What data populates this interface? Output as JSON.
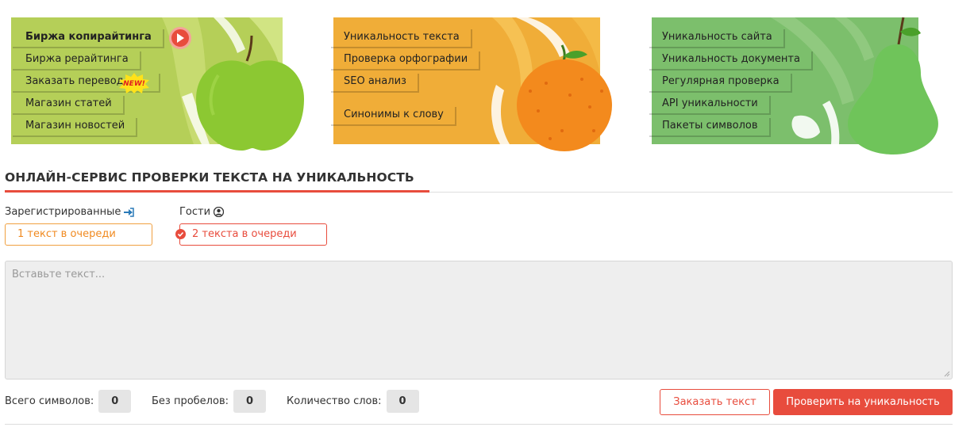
{
  "banners": {
    "copywriting": {
      "links": [
        "Биржа копирайтинга",
        "Биржа рерайтинга",
        "Заказать перевод",
        "Магазин статей",
        "Магазин новостей"
      ],
      "badge": "NEW!",
      "color": "#b5cf58"
    },
    "text_tools": {
      "links": [
        "Уникальность текста",
        "Проверка орфографии",
        "SEO анализ",
        "Синонимы к слову"
      ],
      "color": "#f0ad38"
    },
    "site_tools": {
      "links": [
        "Уникальность сайта",
        "Уникальность документа",
        "Регулярная проверка",
        "API уникальности",
        "Пакеты символов"
      ],
      "color": "#7cbf6c"
    }
  },
  "page_title": "ОНЛАЙН-СЕРВИС ПРОВЕРКИ ТЕКСТА НА УНИКАЛЬНОСТЬ",
  "queue": {
    "registered_label": "Зарегистрированные",
    "registered_value": "1 текст в очереди",
    "guests_label": "Гости",
    "guests_value": "2 текста в очереди"
  },
  "text_input": {
    "placeholder": "Вставьте текст...",
    "value": ""
  },
  "stats": {
    "total_label": "Всего символов:",
    "total_value": "0",
    "nospace_label": "Без пробелов:",
    "nospace_value": "0",
    "words_label": "Количество слов:",
    "words_value": "0"
  },
  "buttons": {
    "order": "Заказать текст",
    "check": "Проверить на уникальность"
  },
  "colors": {
    "accent": "#e84c3d",
    "orange": "#f08a20"
  }
}
